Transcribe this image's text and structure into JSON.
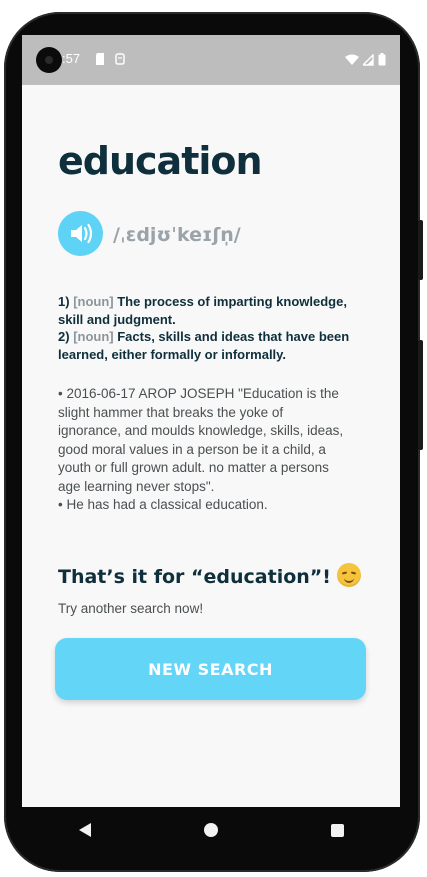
{
  "status_bar": {
    "time": ":57"
  },
  "word": "education",
  "phonetic": "/ˌɛdjʊˈkeɪʃn̩/",
  "definitions": [
    {
      "num": "1)",
      "pos": "[noun]",
      "text": "The process of imparting knowledge, skill and judgment."
    },
    {
      "num": "2)",
      "pos": "[noun]",
      "text": "Facts, skills and ideas that have been learned, either formally or informally."
    }
  ],
  "examples": [
    "• 2016-06-17 AROP JOSEPH \"Education is the slight hammer that breaks the yoke of ignorance, and moulds knowledge, skills, ideas, good moral values in a person be it a child, a youth or full grown adult. no matter a persons age learning never stops\".",
    "• He has had a classical education."
  ],
  "end_message": "That’s it for “education”!",
  "try_text": "Try another search now!",
  "new_search_label": "NEW SEARCH",
  "icons": {
    "speaker": "speaker-icon",
    "emoji": "smiling-face-icon",
    "nav_back": "back-icon",
    "nav_home": "home-icon",
    "nav_recents": "recents-icon"
  },
  "colors": {
    "accent": "#5fd3f5",
    "title": "#0e2f3b",
    "muted": "#8b959a"
  }
}
